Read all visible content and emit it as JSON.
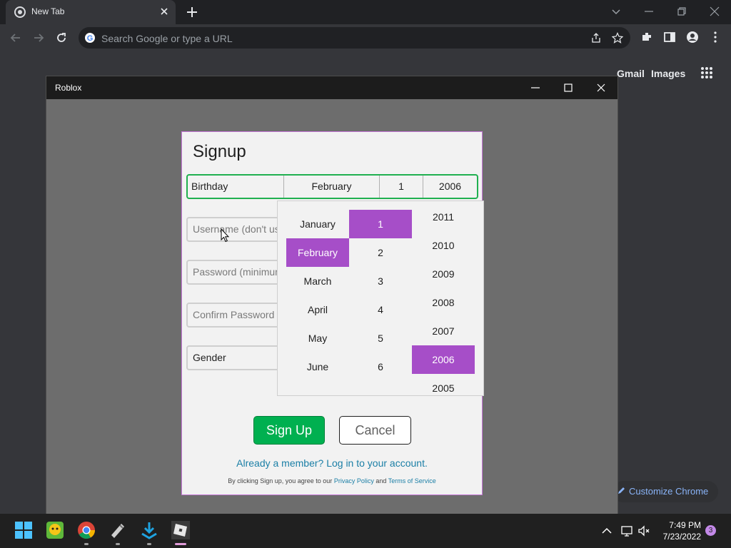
{
  "chrome": {
    "tab_title": "New Tab",
    "omnibox_placeholder": "Search Google or type a URL",
    "ntp_links": [
      "Gmail",
      "Images"
    ],
    "customize_label": "Customize Chrome"
  },
  "roblox_window": {
    "title": "Roblox"
  },
  "signup": {
    "title": "Signup",
    "birthday_label": "Birthday",
    "birthday_month": "February",
    "birthday_day": "1",
    "birthday_year": "2006",
    "username_placeholder": "Username (don't us",
    "password_placeholder": "Password (minimum",
    "confirm_placeholder": "Confirm Password",
    "gender_label": "Gender",
    "signup_button": "Sign Up",
    "cancel_button": "Cancel",
    "login_link": "Already a member? Log in to your account.",
    "terms_prefix": "By clicking Sign up, you agree to our",
    "privacy_link": "Privacy Policy",
    "terms_and": "and",
    "terms_link": "Terms of Service"
  },
  "picker": {
    "months": [
      "January",
      "February",
      "March",
      "April",
      "May",
      "June"
    ],
    "days": [
      "1",
      "2",
      "3",
      "4",
      "5",
      "6"
    ],
    "years": [
      "2011",
      "2010",
      "2009",
      "2008",
      "2007",
      "2006",
      "2005"
    ],
    "selected_month": "February",
    "selected_day": "1",
    "selected_year": "2006"
  },
  "taskbar": {
    "time": "7:49 PM",
    "date": "7/23/2022",
    "notification_count": "3"
  },
  "colors": {
    "accent_purple": "#a64ec8",
    "signup_green": "#00b050",
    "link_blue": "#1b7fa6"
  }
}
